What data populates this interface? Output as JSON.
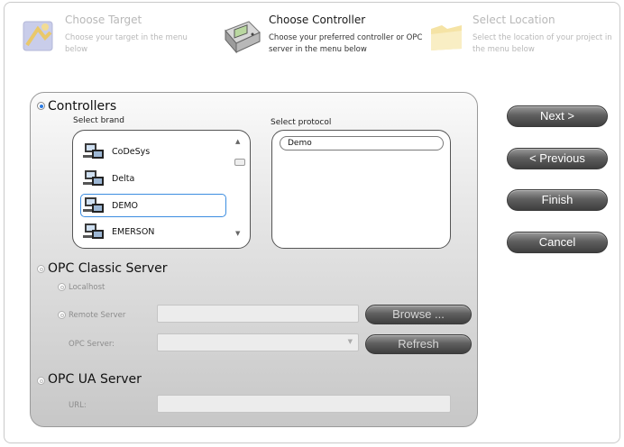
{
  "steps": [
    {
      "title": "Choose Target",
      "desc": "Choose your target in the menu below"
    },
    {
      "title": "Choose Controller",
      "desc": "Choose your preferred controller or OPC server in the menu below"
    },
    {
      "title": "Select Location",
      "desc": "Select the location of your project in the menu below"
    }
  ],
  "controllers": {
    "label": "Controllers",
    "brand_label": "Select brand",
    "protocol_label": "Select protocol",
    "brands": [
      "CoDeSys",
      "Delta",
      "DEMO",
      "EMERSON"
    ],
    "selected_brand": "DEMO",
    "protocols": [
      "Demo"
    ]
  },
  "opc_classic": {
    "label": "OPC Classic Server",
    "localhost_label": "Localhost",
    "remote_label": "Remote Server",
    "remote_value": "",
    "browse_label": "Browse ...",
    "opc_server_label": "OPC Server:",
    "opc_server_value": "",
    "refresh_label": "Refresh"
  },
  "opc_ua": {
    "label": "OPC UA Server",
    "url_label": "URL:",
    "url_value": ""
  },
  "nav": {
    "next": "Next >",
    "previous": "< Previous",
    "finish": "Finish",
    "cancel": "Cancel"
  }
}
